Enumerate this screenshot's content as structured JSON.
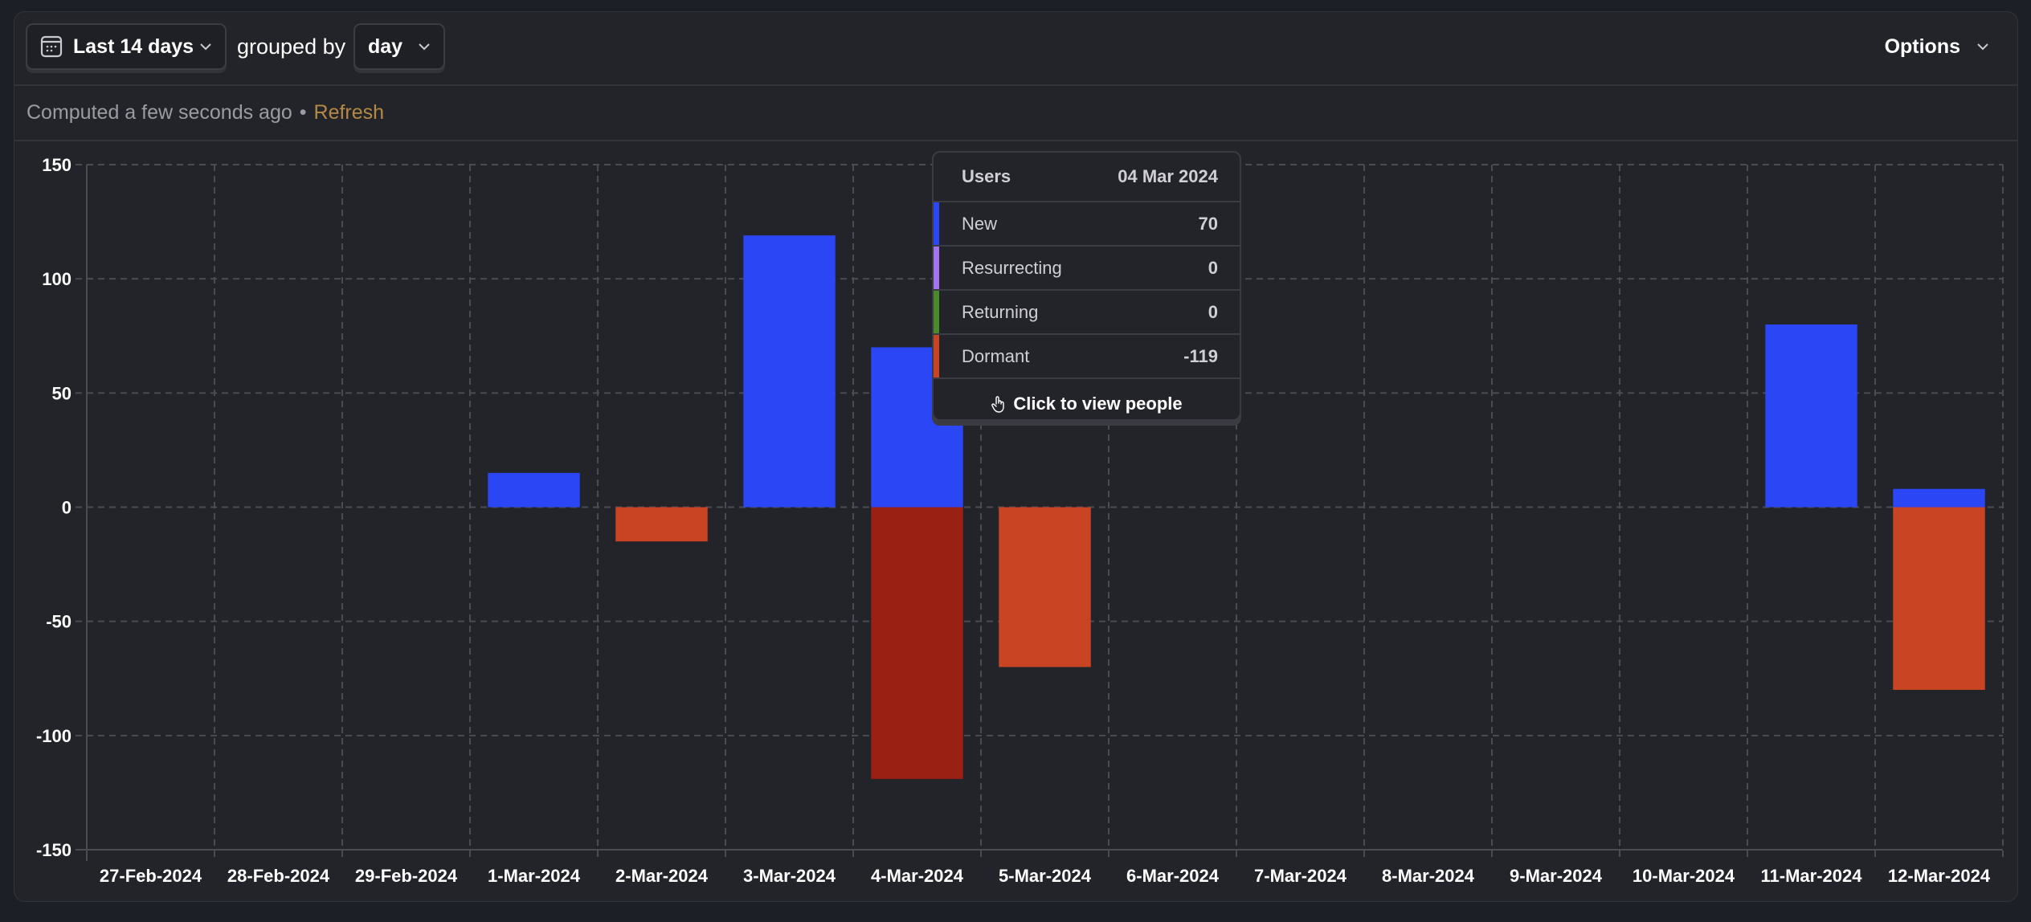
{
  "toolbar": {
    "date_range_label": "Last 14 days",
    "grouped_by_label": "grouped by",
    "interval_label": "day",
    "options_label": "Options",
    "calendar_icon": "calendar-icon",
    "chevron_icon": "chevron-down-icon"
  },
  "status": {
    "computed_text": "Computed a few seconds ago",
    "separator": "•",
    "refresh_label": "Refresh"
  },
  "colors": {
    "new": "#2b46f5",
    "resurrecting": "#a374f2",
    "returning": "#4a8a2a",
    "dormant": "#c94422",
    "dormant_hover": "#9a2014",
    "refresh": "#b58945"
  },
  "tooltip": {
    "title": "Users",
    "date": "04 Mar 2024",
    "rows": [
      {
        "label": "New",
        "value": "70",
        "series": "new"
      },
      {
        "label": "Resurrecting",
        "value": "0",
        "series": "resurrecting"
      },
      {
        "label": "Returning",
        "value": "0",
        "series": "returning"
      },
      {
        "label": "Dormant",
        "value": "-119",
        "series": "dormant"
      }
    ],
    "action_label": "Click to view people",
    "action_icon": "hand-pointer-icon"
  },
  "chart_data": {
    "type": "bar",
    "stacked": true,
    "title": "",
    "xlabel": "",
    "ylabel": "",
    "ylim": [
      -150,
      150
    ],
    "yticks": [
      150,
      100,
      50,
      0,
      -50,
      -100,
      -150
    ],
    "grid": true,
    "legend": "tooltip",
    "categories": [
      "27-Feb-2024",
      "28-Feb-2024",
      "29-Feb-2024",
      "1-Mar-2024",
      "2-Mar-2024",
      "3-Mar-2024",
      "4-Mar-2024",
      "5-Mar-2024",
      "6-Mar-2024",
      "7-Mar-2024",
      "8-Mar-2024",
      "9-Mar-2024",
      "10-Mar-2024",
      "11-Mar-2024",
      "12-Mar-2024"
    ],
    "series": [
      {
        "name": "New",
        "key": "new",
        "values": [
          0,
          0,
          0,
          15,
          0,
          119,
          70,
          0,
          0,
          0,
          0,
          0,
          0,
          80,
          8
        ]
      },
      {
        "name": "Resurrecting",
        "key": "resurrecting",
        "values": [
          0,
          0,
          0,
          0,
          0,
          0,
          0,
          0,
          0,
          0,
          0,
          0,
          0,
          0,
          0
        ]
      },
      {
        "name": "Returning",
        "key": "returning",
        "values": [
          0,
          0,
          0,
          0,
          0,
          0,
          0,
          0,
          0,
          0,
          0,
          0,
          0,
          0,
          0
        ]
      },
      {
        "name": "Dormant",
        "key": "dormant",
        "values": [
          0,
          0,
          0,
          0,
          -15,
          0,
          -119,
          -70,
          0,
          0,
          0,
          0,
          0,
          0,
          -80
        ]
      }
    ],
    "highlighted_category": "4-Mar-2024"
  }
}
